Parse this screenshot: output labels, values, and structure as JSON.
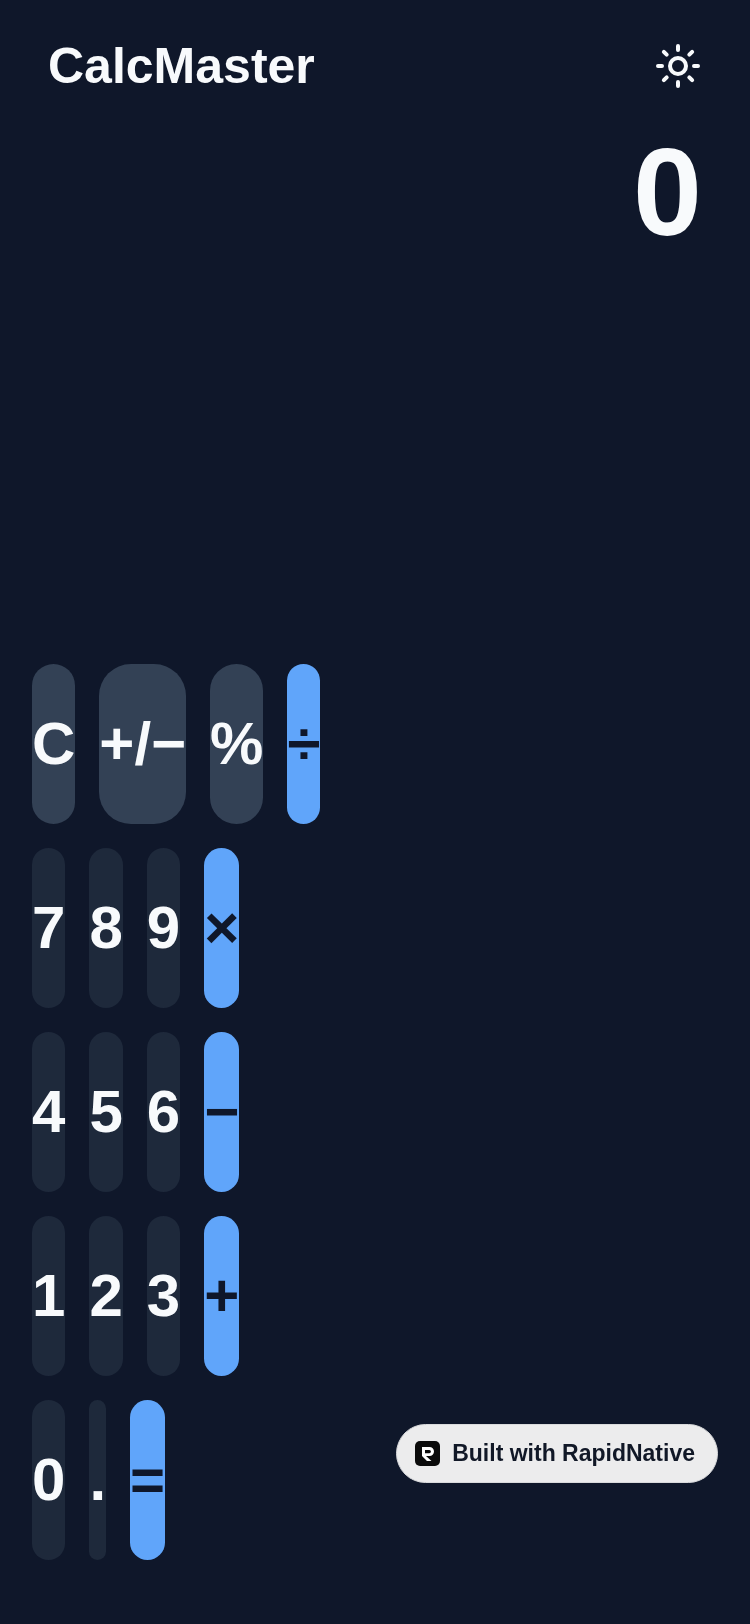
{
  "header": {
    "title": "CalcMaster"
  },
  "display": {
    "value": "0"
  },
  "keypad": {
    "rows": [
      {
        "keys": [
          {
            "label": "C",
            "kind": "function"
          },
          {
            "label": "+/−",
            "kind": "function"
          },
          {
            "label": "%",
            "kind": "function"
          },
          {
            "label": "÷",
            "kind": "operator"
          }
        ]
      },
      {
        "keys": [
          {
            "label": "7",
            "kind": "digit"
          },
          {
            "label": "8",
            "kind": "digit"
          },
          {
            "label": "9",
            "kind": "digit"
          },
          {
            "label": "×",
            "kind": "operator"
          }
        ]
      },
      {
        "keys": [
          {
            "label": "4",
            "kind": "digit"
          },
          {
            "label": "5",
            "kind": "digit"
          },
          {
            "label": "6",
            "kind": "digit"
          },
          {
            "label": "−",
            "kind": "operator"
          }
        ]
      },
      {
        "keys": [
          {
            "label": "1",
            "kind": "digit"
          },
          {
            "label": "2",
            "kind": "digit"
          },
          {
            "label": "3",
            "kind": "digit"
          },
          {
            "label": "+",
            "kind": "operator"
          }
        ]
      },
      {
        "keys": [
          {
            "label": "0",
            "kind": "digit"
          },
          {
            "label": ".",
            "kind": "digit"
          },
          {
            "label": "=",
            "kind": "operator"
          }
        ]
      }
    ]
  },
  "badge": {
    "text": "Built with RapidNative"
  }
}
